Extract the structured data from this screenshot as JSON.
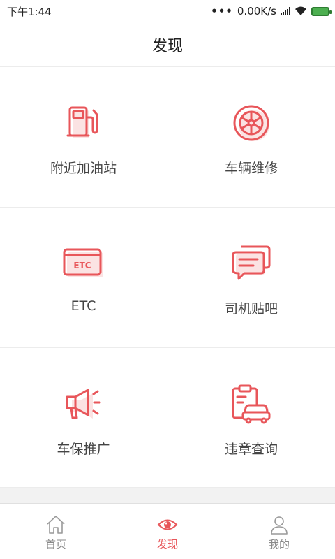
{
  "status_bar": {
    "time": "下午1:44",
    "dots": "•••",
    "network_speed": "0.00K/s"
  },
  "header": {
    "title": "发现"
  },
  "grid": {
    "items": [
      {
        "label": "附近加油站",
        "icon": "gas-station-icon"
      },
      {
        "label": "车辆维修",
        "icon": "wheel-icon"
      },
      {
        "label": "ETC",
        "icon": "etc-card-icon",
        "icon_text": "ETC"
      },
      {
        "label": "司机贴吧",
        "icon": "chat-bubbles-icon"
      },
      {
        "label": "车保推广",
        "icon": "megaphone-icon"
      },
      {
        "label": "违章查询",
        "icon": "car-clipboard-icon"
      }
    ]
  },
  "tabbar": {
    "tabs": [
      {
        "label": "首页",
        "icon": "home-icon",
        "active": false
      },
      {
        "label": "发现",
        "icon": "eye-icon",
        "active": true
      },
      {
        "label": "我的",
        "icon": "user-icon",
        "active": false
      }
    ]
  },
  "colors": {
    "accent": "#e8565a",
    "accent_shadow": "#fbe3e3",
    "inactive": "#888888",
    "divider": "#ececec"
  }
}
